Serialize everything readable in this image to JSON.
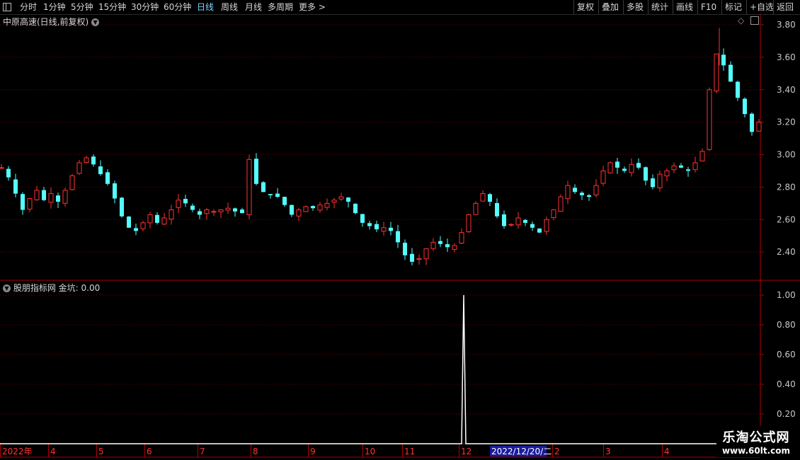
{
  "toolbar": {
    "left_items": [
      "分时",
      "1分钟",
      "5分钟",
      "15分钟",
      "30分钟",
      "60分钟",
      "日线",
      "周线",
      "月线",
      "多周期",
      "更多"
    ],
    "more_arrow": ">",
    "active": "日线",
    "right_items": [
      "复权",
      "叠加",
      "多股",
      "统计",
      "画线",
      "F10",
      "标记",
      "+自选",
      "返回"
    ]
  },
  "main_panel": {
    "title": "中原高速(日线,前复权)",
    "y_ticks": [
      "3.80",
      "3.60",
      "3.40",
      "3.20",
      "3.00",
      "2.80",
      "2.60",
      "2.40"
    ]
  },
  "indicator_panel": {
    "name": "股朋指标网",
    "value_label": "金坑: 0.00",
    "y_ticks": [
      "1.00",
      "0.80",
      "0.60",
      "0.40",
      "0.20"
    ]
  },
  "x_axis": {
    "labels": [
      "2022年",
      "4",
      "5",
      "6",
      "7",
      "8",
      "9",
      "10",
      "11",
      "12",
      "2",
      "3",
      "4"
    ],
    "cursor_date": "2022/12/20/二"
  },
  "watermark": {
    "title": "乐淘公式网",
    "url": "www.60lt.com"
  },
  "colors": {
    "up": "#ff3232",
    "down": "#54ffff",
    "grid": "#7a0000",
    "axis": "#b00000",
    "signal": "#ffffff"
  },
  "chart_data": [
    {
      "type": "candlestick",
      "title": "中原高速(日线,前复权)",
      "ylim": [
        2.27,
        3.85
      ],
      "x": [
        "2022年",
        "4",
        "5",
        "6",
        "7",
        "8",
        "9",
        "10",
        "11",
        "12",
        "2",
        "3",
        "4"
      ],
      "close_path": [
        [
          2.92,
          2.86,
          2.76,
          2.66,
          2.73,
          2.78,
          2.72,
          2.76,
          2.71,
          2.78,
          2.87,
          2.95
        ],
        [
          2.98,
          2.94,
          2.88,
          2.82,
          2.73,
          2.62,
          2.55,
          2.53,
          2.58,
          2.63,
          2.58,
          2.61
        ],
        [
          2.66,
          2.72,
          2.7,
          2.66,
          2.63,
          2.66,
          2.65,
          2.66,
          2.67,
          2.65,
          2.64,
          2.97
        ],
        [
          2.82,
          2.77,
          2.75,
          2.74,
          2.69,
          2.63,
          2.66,
          2.68,
          2.67,
          2.69,
          2.7,
          2.72
        ],
        [
          2.74,
          2.71,
          2.64,
          2.58,
          2.56,
          2.54,
          2.55,
          2.53,
          2.46,
          2.38,
          2.34,
          2.36
        ],
        [
          2.42,
          2.46,
          2.45,
          2.43,
          2.44,
          2.52,
          2.63,
          2.7,
          2.76,
          2.71,
          2.62,
          2.56
        ],
        [
          2.57,
          2.61,
          2.58,
          2.55,
          2.52,
          2.6,
          2.66,
          2.74,
          2.81,
          2.77,
          2.75,
          2.74
        ],
        [
          2.81,
          2.9,
          2.95,
          2.92,
          2.9,
          2.94,
          2.92,
          2.84,
          2.8,
          2.88,
          2.9,
          2.93
        ],
        [
          2.92,
          2.9,
          2.95,
          3.02,
          3.4,
          3.62,
          3.55,
          3.45,
          3.35,
          3.25,
          3.14,
          3.2
        ]
      ]
    },
    {
      "type": "line",
      "series": [
        {
          "name": "金坑",
          "values": [
            0,
            1,
            0
          ]
        }
      ],
      "signal_date": "2022/12/20",
      "ylim": [
        0,
        1.05
      ]
    }
  ]
}
